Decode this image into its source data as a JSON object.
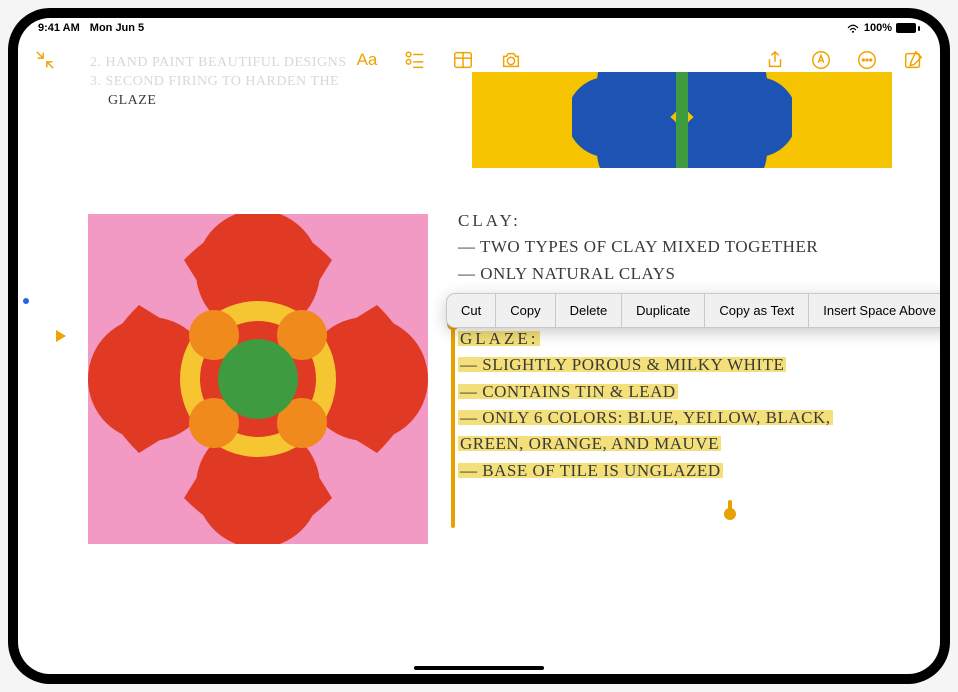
{
  "status": {
    "time": "9:41 AM",
    "date": "Mon Jun 5",
    "battery_pct": "100%"
  },
  "toolbar": {
    "more": "• • •",
    "exit_fullscreen": "exit-fullscreen",
    "text_format_label": "Aa"
  },
  "top_faint": {
    "line1": "2. HAND PAINT BEAUTIFUL DESIGNS",
    "line2": "3. SECOND FIRING TO HARDEN THE"
  },
  "top_notes": {
    "line3": "GLAZE"
  },
  "clay": {
    "title": "CLAY:",
    "line1": "— TWO TYPES OF CLAY MIXED TOGETHER",
    "line2": "— ONLY NATURAL CLAYS"
  },
  "glaze": {
    "title": "GLAZE:",
    "line1": "— SLIGHTLY POROUS & MILKY WHITE",
    "line2": "— CONTAINS TIN & LEAD",
    "line3": "— ONLY 6 COLORS: BLUE, YELLOW, BLACK,",
    "line3b": "   GREEN, ORANGE, AND MAUVE",
    "line4": "— BASE OF TILE IS UNGLAZED"
  },
  "context_menu": {
    "items": [
      "Cut",
      "Copy",
      "Delete",
      "Duplicate",
      "Copy as Text",
      "Insert Space Above"
    ]
  },
  "colors": {
    "accent": "#f0a300",
    "highlight": "#f4e07a",
    "flower_bg": "#f29ac3",
    "petal": "#e03a24",
    "ring_outer": "#f5c631",
    "small_circle": "#f08a1c",
    "center": "#3f9b3f",
    "top_art_bg": "#f5c300",
    "top_art_blue": "#1d54b4",
    "top_art_stem": "#3f9b3f"
  }
}
